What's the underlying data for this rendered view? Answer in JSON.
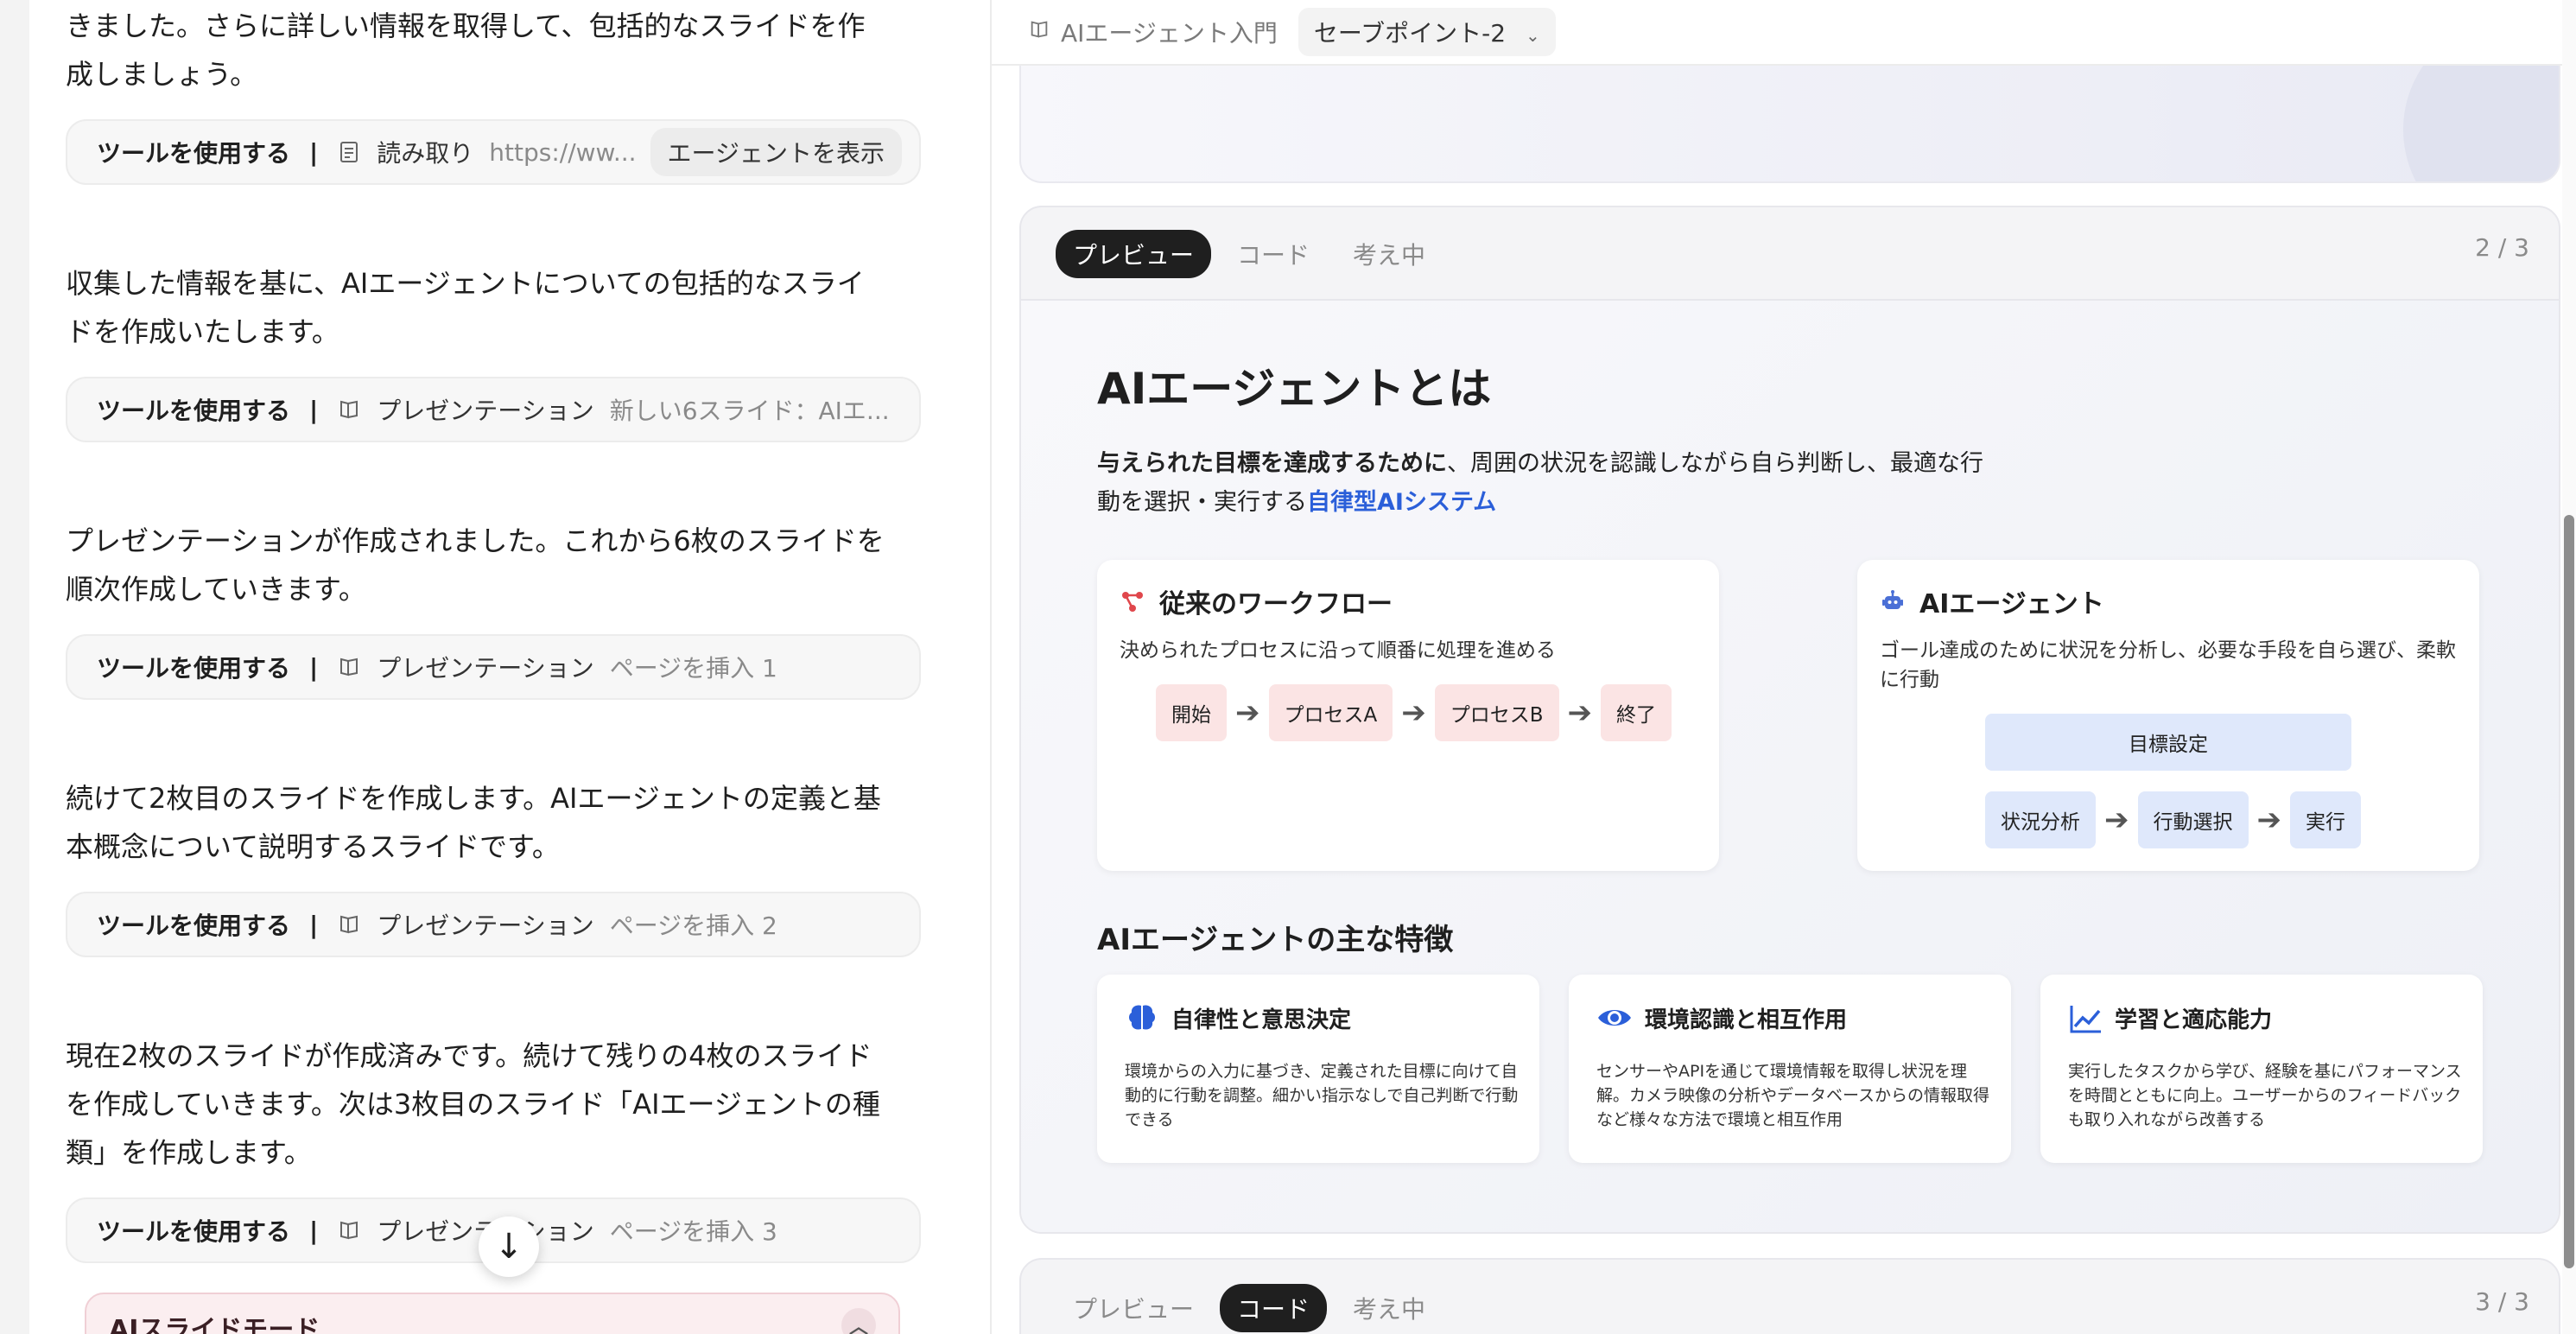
{
  "chat": {
    "messages": [
      {
        "line1": "きました。さらに詳しい情報を取得して、包括的なスライドを作",
        "line2": "成しましょう。"
      },
      {
        "line1": "収集した情報を基に、AIエージェントについての包括的なスライ",
        "line2": "ドを作成いたします。"
      },
      {
        "line1": "プレゼンテーションが作成されました。これから6枚のスライドを",
        "line2": "順次作成していきます。"
      },
      {
        "line1": "続けて2枚目のスライドを作成します。AIエージェントの定義と基",
        "line2": "本概念について説明するスライドです。"
      },
      {
        "line1": "現在2枚のスライドが作成済みです。続けて残りの4枚のスライド",
        "line2": "を作成していきます。次は3枚目のスライド「AIエージェントの種",
        "line3": "類」を作成します。"
      }
    ],
    "tools": [
      {
        "use": "ツールを使用する",
        "sep": "|",
        "name": "読み取り",
        "detail": "https://ww...",
        "button": "エージェントを表示"
      },
      {
        "use": "ツールを使用する",
        "sep": "|",
        "name": "プレゼンテーション",
        "detail": "新しい6スライド：AIエ..."
      },
      {
        "use": "ツールを使用する",
        "sep": "|",
        "name": "プレゼンテーション",
        "detail": "ページを挿入 1"
      },
      {
        "use": "ツールを使用する",
        "sep": "|",
        "name": "プレゼンテーション",
        "detail": "ページを挿入 2"
      },
      {
        "use": "ツールを使用する",
        "sep": "|",
        "name": "プレゼンテーション",
        "detail": "ページを挿入 3"
      }
    ],
    "ai_mode_label": "AIスライドモード"
  },
  "topbar": {
    "breadcrumb": "AIエージェント入門",
    "version": "セーブポイント-2"
  },
  "card_main": {
    "tabs": [
      "プレビュー",
      "コード",
      "考え中"
    ],
    "active_tab": "プレビュー",
    "pager": "2 / 3"
  },
  "card_next": {
    "tabs": [
      "プレビュー",
      "コード",
      "考え中"
    ],
    "active_tab": "コード",
    "pager": "3 / 3"
  },
  "slide": {
    "title": "AIエージェントとは",
    "def_bold": "与えられた目標を達成するために",
    "def_text1": "、周囲の状況を認識しながら自ら判断し、最適な行",
    "def_text2": "動を選択・実行する",
    "def_highlight": "自律型AIシステム",
    "left_panel": {
      "title": "従来のワークフロー",
      "desc": "決められたプロセスに沿って順番に処理を進める",
      "steps": [
        "開始",
        "プロセスA",
        "プロセスB",
        "終了"
      ]
    },
    "right_panel": {
      "title": "AIエージェント",
      "desc": "ゴール達成のために状況を分析し、必要な手段を自ら選び、柔軟に行動",
      "goal": "目標設定",
      "steps": [
        "状況分析",
        "行動選択",
        "実行"
      ]
    },
    "features_title": "AIエージェントの主な特徴",
    "features": [
      {
        "title": "自律性と意思決定",
        "desc": "環境からの入力に基づき、定義された目標に向けて自動的に行動を調整。細かい指示なしで自己判断で行動できる"
      },
      {
        "title": "環境認識と相互作用",
        "desc": "センサーやAPIを通じて環境情報を取得し状況を理解。カメラ映像の分析やデータベースからの情報取得など様々な方法で環境と相互作用"
      },
      {
        "title": "学習と適応能力",
        "desc": "実行したタスクから学び、経験を基にパフォーマンスを時間とともに向上。ユーザーからのフィードバックも取り入れながら改善する"
      }
    ]
  },
  "colors": {
    "accent_blue": "#2b5fd9",
    "workflow_red": "#e0474c",
    "step_red_bg": "#fbe4e4",
    "step_blue_bg": "#dfe8fb"
  },
  "icons": {
    "tool_read": "document-icon",
    "tool_presentation": "presentation-icon",
    "workflow": "workflow-icon",
    "robot": "robot-icon",
    "brain": "brain-icon",
    "eye": "eye-icon",
    "chart": "chart-line-icon"
  }
}
